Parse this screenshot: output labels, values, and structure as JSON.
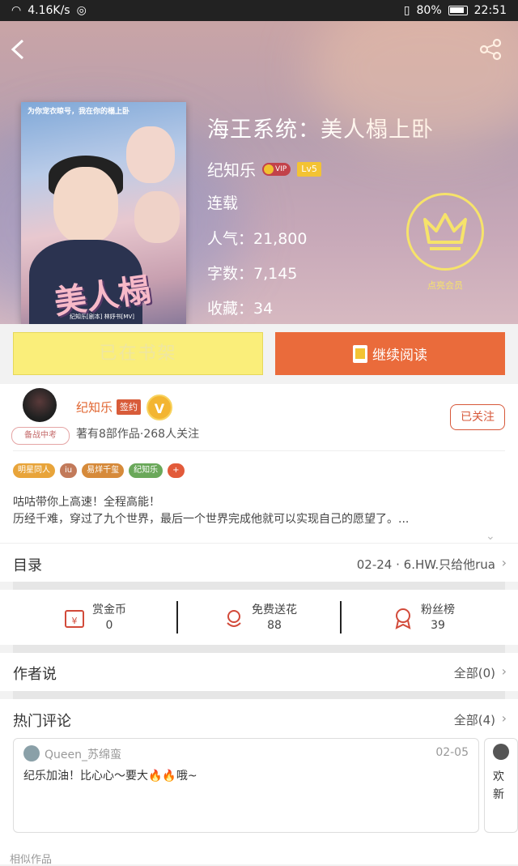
{
  "status": {
    "speed": "4.16K/s",
    "battery": "80%",
    "time": "22:51"
  },
  "book": {
    "cover_top": "为你宠衣晾号，我在你的榻上卧",
    "cover_title": "美人榻",
    "cover_bottom": "纪知乐[剧本] 林妤书[MV]",
    "title": "海王系统：美人榻上卧",
    "author": "纪知乐",
    "vip_label": "VIP",
    "level": "Lv5",
    "status": "连载",
    "popularity": "人气：21,800",
    "word_count": "字数：7,145",
    "favorites": "收藏：34",
    "member_label": "点亮会员"
  },
  "buttons": {
    "shelf": "已在书架",
    "read": "继续阅读",
    "follow": "已关注"
  },
  "author": {
    "badge": "备战中考",
    "name": "纪知乐",
    "sign": "签约",
    "vmark": "V",
    "info": "著有8部作品·268人关注"
  },
  "tags": [
    {
      "label": "明星同人",
      "color": "#e8a43a"
    },
    {
      "label": "iu",
      "color": "#c27a5a"
    },
    {
      "label": "易烊千玺",
      "color": "#d68a3a"
    },
    {
      "label": "纪知乐",
      "color": "#6aa85a"
    },
    {
      "label": "+",
      "color": "#e25a3a"
    }
  ],
  "description": {
    "line1": "咕咕带你上高速！全程高能！",
    "line2": "历经千难，穿过了九个世界，最后一个世界完成他就可以实现自己的愿望了。..."
  },
  "toc": {
    "label": "目录",
    "latest": "02-24 · 6.HW.只给他rua"
  },
  "actions": [
    {
      "label": "赏金币",
      "count": "0"
    },
    {
      "label": "免费送花",
      "count": "88"
    },
    {
      "label": "粉丝榜",
      "count": "39"
    }
  ],
  "author_says": {
    "label": "作者说",
    "value": "全部(0)"
  },
  "hot_comments": {
    "label": "热门评论",
    "value": "全部(4)"
  },
  "comment": {
    "user": "Queen_苏绵蛮",
    "date": "02-05",
    "text": "纪乐加油！比心心～要大🔥🔥哦~"
  },
  "comment2": {
    "line1": "欢",
    "line2": "新"
  },
  "similar": "相似作品",
  "colors": {
    "accent": "#ea6b3b",
    "shelf": "#faee7a",
    "crown": "#f6e36a"
  }
}
